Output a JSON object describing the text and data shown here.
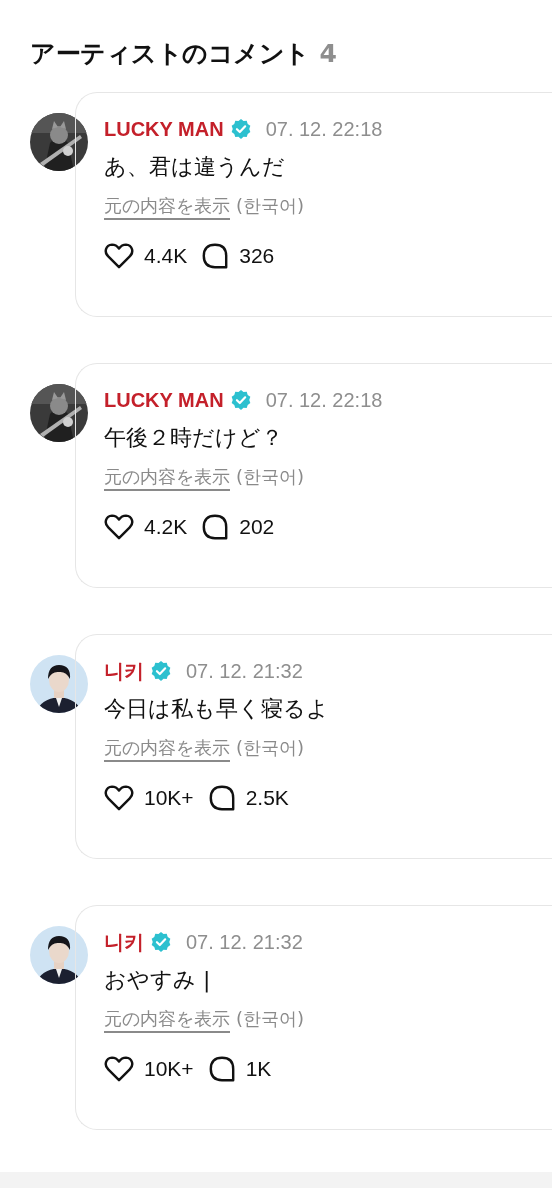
{
  "section": {
    "title": "アーティストのコメント",
    "count": "4"
  },
  "comments": [
    {
      "author": "LUCKY MAN",
      "verified": true,
      "time": "07. 12. 22:18",
      "text": "あ、君は違うんだ",
      "original_link": "元の内容を表示",
      "original_language": "(한국어)",
      "likes": "4.4K",
      "replies": "326"
    },
    {
      "author": "LUCKY MAN",
      "verified": true,
      "time": "07. 12. 22:18",
      "text": "午後２時だけど？",
      "original_link": "元の内容を表示",
      "original_language": "(한국어)",
      "likes": "4.2K",
      "replies": "202"
    },
    {
      "author": "니키",
      "verified": true,
      "time": "07. 12. 21:32",
      "text": "今日は私も早く寝るよ",
      "original_link": "元の内容を表示",
      "original_language": "(한국어)",
      "likes": "10K+",
      "replies": "2.5K"
    },
    {
      "author": "니키",
      "verified": true,
      "time": "07. 12. 21:32",
      "text": "おやすみ |",
      "original_link": "元の内容を表示",
      "original_language": "(한국어)",
      "likes": "10K+",
      "replies": "1K"
    }
  ]
}
